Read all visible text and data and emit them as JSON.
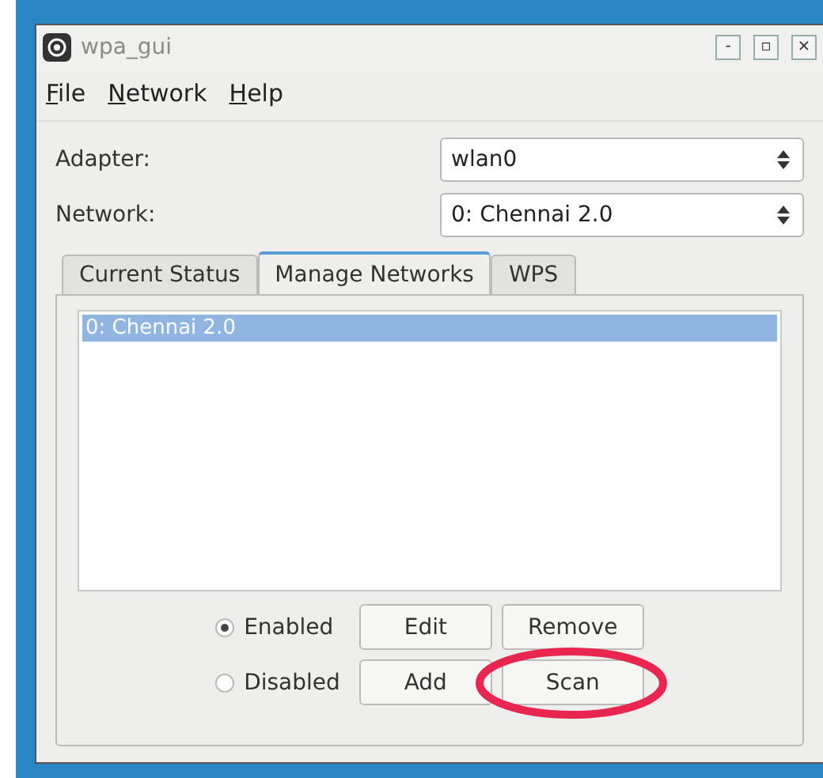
{
  "window": {
    "title": "wpa_gui",
    "controls": [
      "-",
      "▫",
      "×"
    ]
  },
  "menu": [
    {
      "label": "File"
    },
    {
      "label": "Network"
    },
    {
      "label": "Help"
    }
  ],
  "fields": [
    {
      "label": "Adapter:",
      "value": "wlan0"
    },
    {
      "label": "Network:",
      "value": "0: Chennai 2.0"
    }
  ],
  "tabs": [
    {
      "label": "Current Status",
      "selected": false
    },
    {
      "label": "Manage Networks",
      "selected": true
    },
    {
      "label": "WPS",
      "selected": false
    }
  ],
  "networks": [
    {
      "label": "0: Chennai 2.0",
      "selected": true
    }
  ],
  "radios": [
    {
      "label": "Enabled",
      "selected": true
    },
    {
      "label": "Disabled",
      "selected": false
    }
  ],
  "buttons": [
    {
      "label": "Edit",
      "highlighted": false
    },
    {
      "label": "Remove",
      "highlighted": false
    },
    {
      "label": "Add",
      "highlighted": false
    },
    {
      "label": "Scan",
      "highlighted": true
    }
  ]
}
